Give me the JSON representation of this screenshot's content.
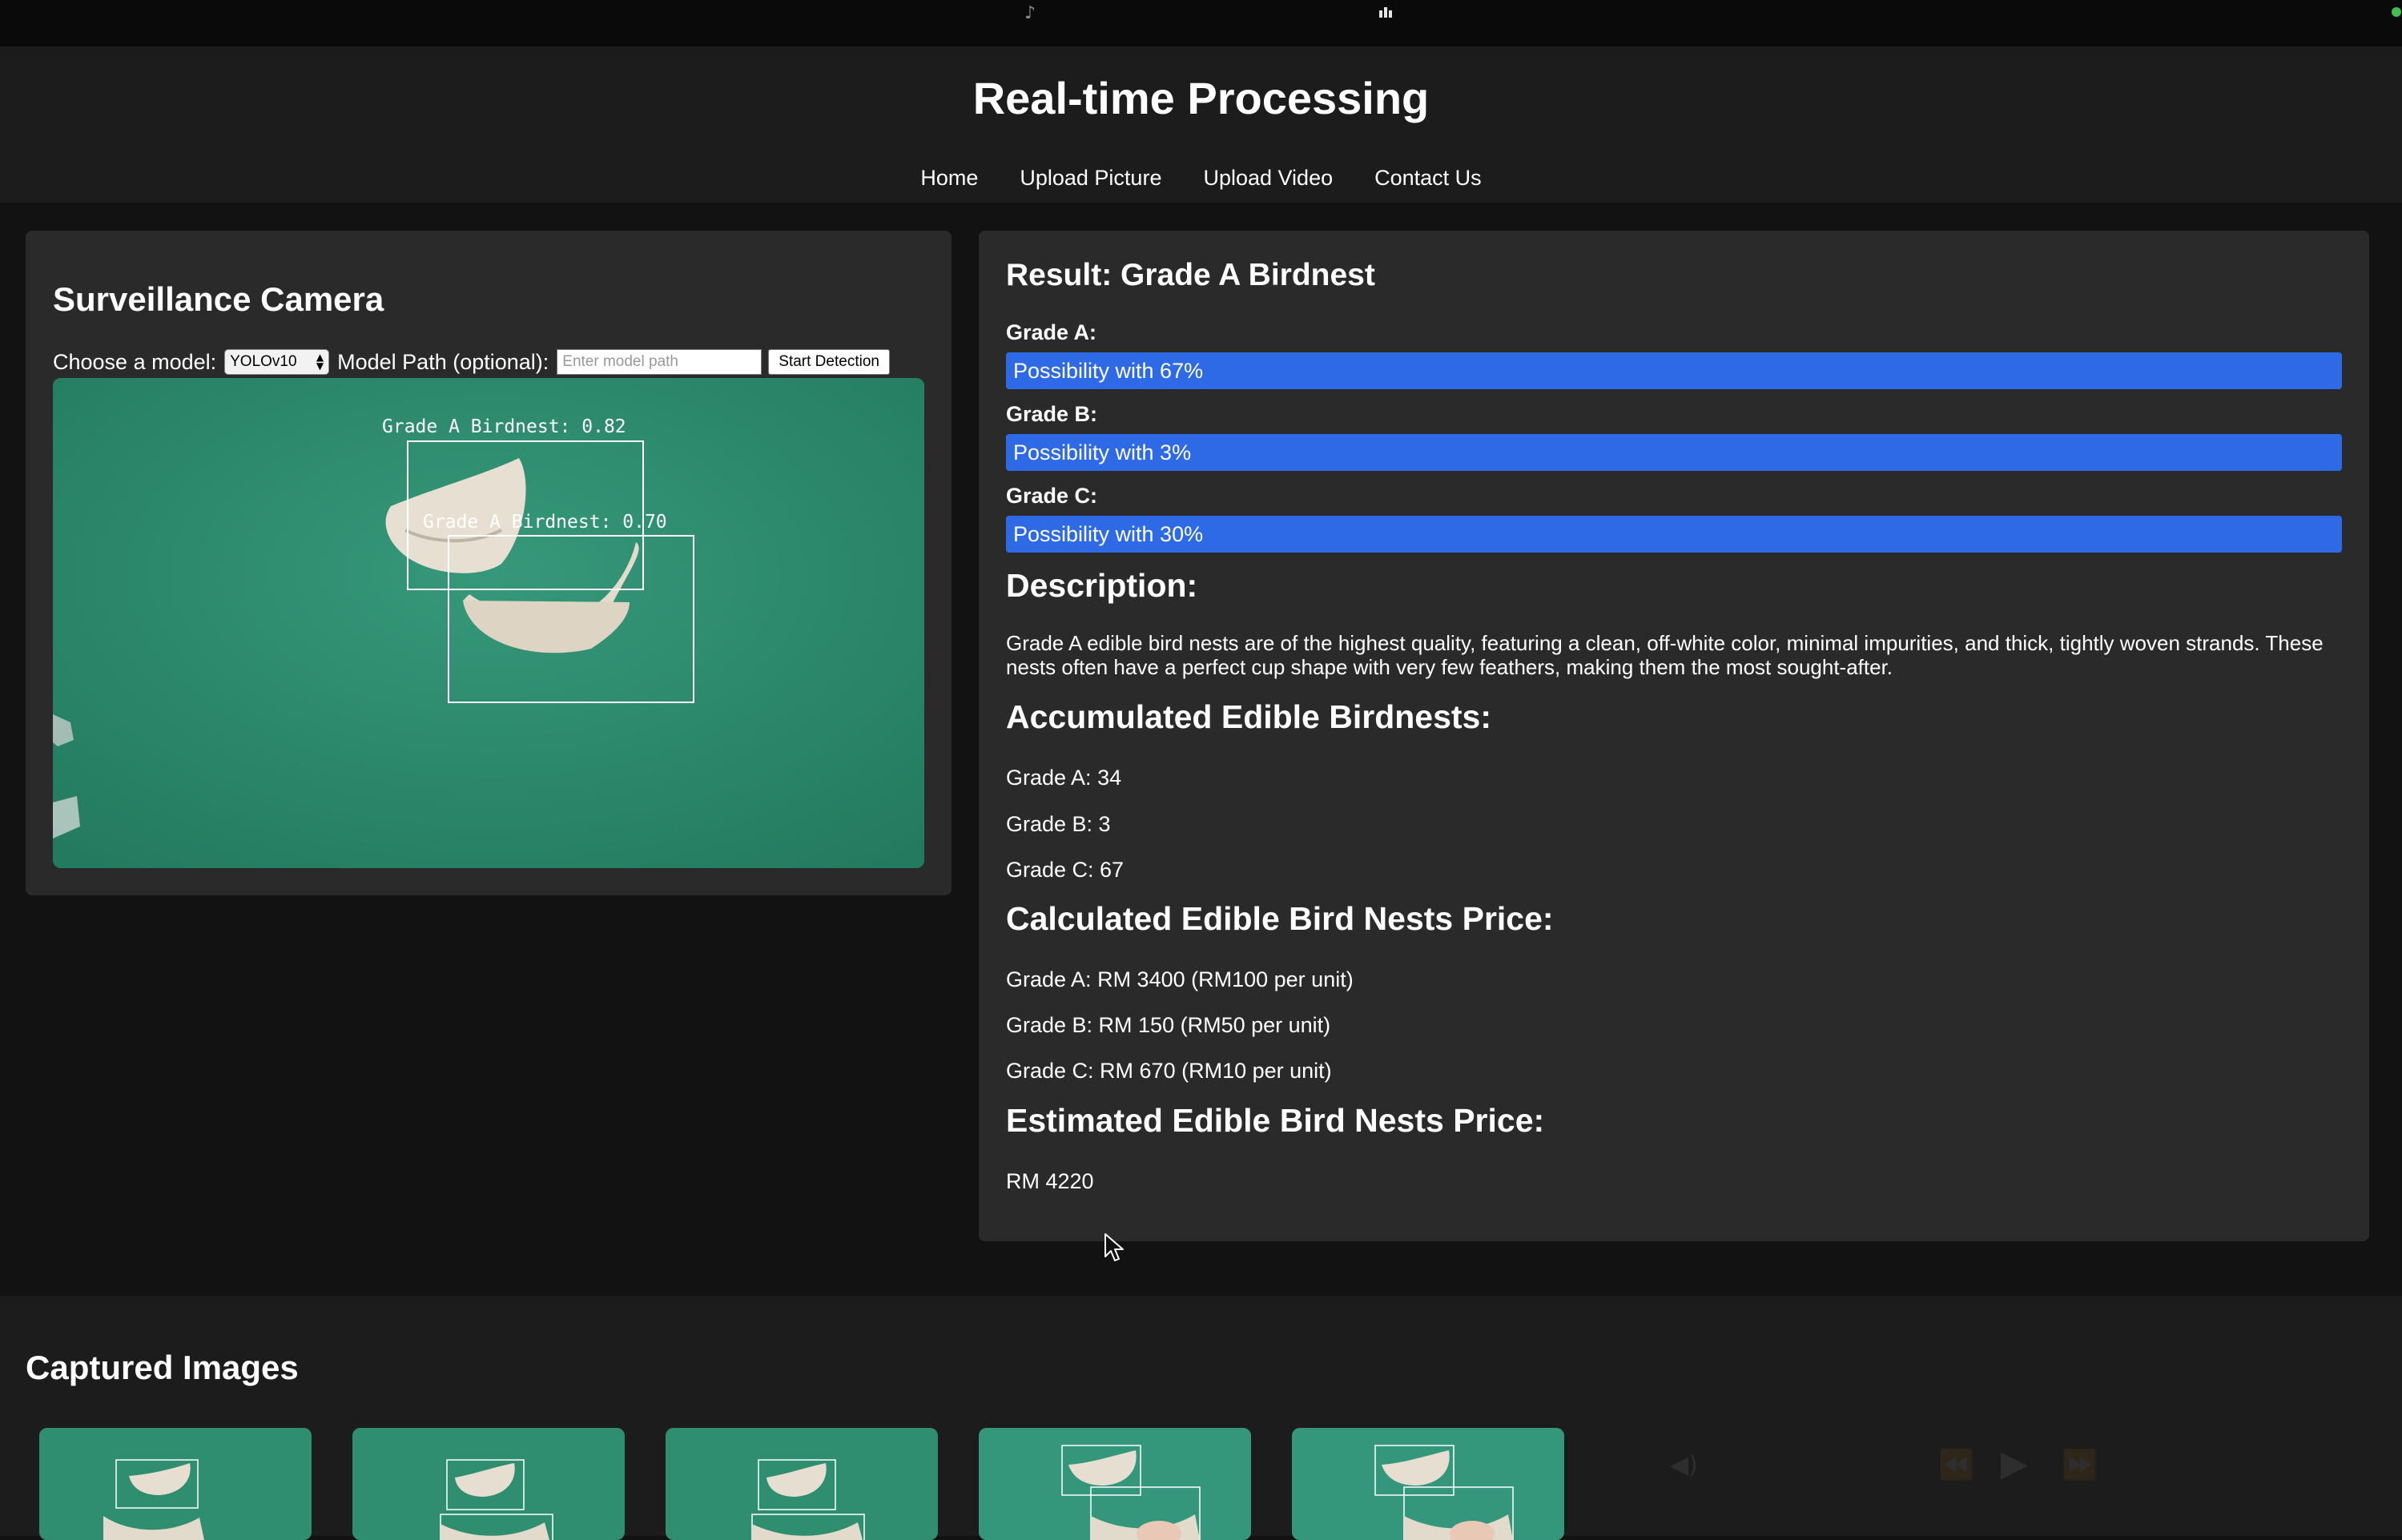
{
  "page": {
    "title": "Real-time Processing",
    "nav": [
      "Home",
      "Upload Picture",
      "Upload Video",
      "Contact Us"
    ]
  },
  "camera": {
    "heading": "Surveillance Camera",
    "model_label": "Choose a model:",
    "model_selected": "YOLOv10",
    "path_label": "Model Path (optional):",
    "path_placeholder": "Enter model path",
    "path_value": "",
    "start_button": "Start Detection",
    "detections": [
      {
        "label": "Grade A Birdnest: 0.82"
      },
      {
        "label": "Grade A Birdnest: 0.70"
      }
    ]
  },
  "result": {
    "title": "Result: Grade A Birdnest",
    "grades": [
      {
        "label": "Grade A:",
        "bar_text": "Possibility with 67%",
        "percent": 67
      },
      {
        "label": "Grade B:",
        "bar_text": "Possibility with 3%",
        "percent": 3
      },
      {
        "label": "Grade C:",
        "bar_text": "Possibility with 30%",
        "percent": 30
      }
    ],
    "description_heading": "Description:",
    "description": "Grade A edible bird nests are of the highest quality, featuring a clean, off-white color, minimal impurities, and thick, tightly woven strands. These nests often have a perfect cup shape with very few feathers, making them the most sought-after.",
    "accumulated_heading": "Accumulated Edible Birdnests:",
    "accumulated": [
      "Grade A: 34",
      "Grade B: 3",
      "Grade C: 67"
    ],
    "calculated_heading": "Calculated Edible Bird Nests Price:",
    "calculated": [
      "Grade A: RM 3400 (RM100 per unit)",
      "Grade B: RM 150 (RM50 per unit)",
      "Grade C: RM 670 (RM10 per unit)"
    ],
    "estimated_heading": "Estimated Edible Bird Nests Price:",
    "estimated": "RM 4220"
  },
  "gallery": {
    "heading": "Captured Images",
    "count": 5
  },
  "colors": {
    "accent_bar": "#2f6ae6",
    "card_bg": "#2a2a2a",
    "page_bg": "#121212",
    "camera_bg": "#2d8a6c"
  },
  "icons": {
    "menubar_left": "music-note-icon",
    "menubar_center": "audio-bars-icon",
    "cursor": "mouse-pointer-icon"
  }
}
